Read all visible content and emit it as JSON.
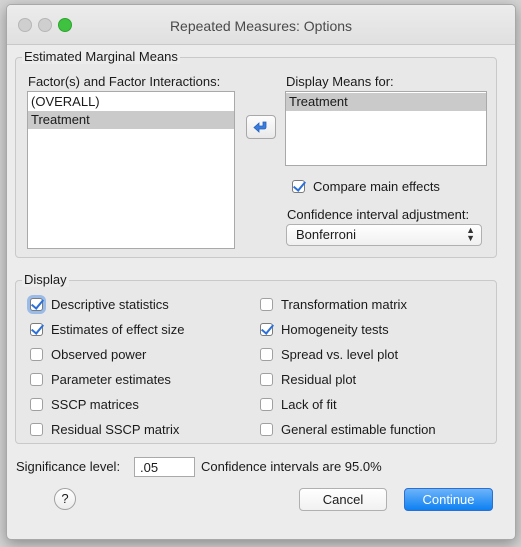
{
  "window": {
    "title": "Repeated Measures: Options"
  },
  "emm": {
    "group_label": "Estimated Marginal Means",
    "factors_label": "Factor(s) and Factor Interactions:",
    "factors": [
      {
        "label": "(OVERALL)",
        "selected": false
      },
      {
        "label": "Treatment",
        "selected": true
      }
    ],
    "display_means_label": "Display Means for:",
    "display_means": [
      {
        "label": "Treatment",
        "selected": true
      }
    ],
    "compare_main_effects": {
      "label": "Compare main effects",
      "checked": true
    },
    "ci_adjustment_label": "Confidence interval adjustment:",
    "ci_adjustment_value": "Bonferroni"
  },
  "display": {
    "group_label": "Display",
    "left": [
      {
        "label": "Descriptive statistics",
        "checked": true
      },
      {
        "label": "Estimates of effect size",
        "checked": true
      },
      {
        "label": "Observed power",
        "checked": false
      },
      {
        "label": "Parameter estimates",
        "checked": false
      },
      {
        "label": "SSCP matrices",
        "checked": false
      },
      {
        "label": "Residual SSCP matrix",
        "checked": false
      }
    ],
    "right": [
      {
        "label": "Transformation matrix",
        "checked": false
      },
      {
        "label": "Homogeneity tests",
        "checked": true
      },
      {
        "label": "Spread vs. level plot",
        "checked": false
      },
      {
        "label": "Residual plot",
        "checked": false
      },
      {
        "label": "Lack of fit",
        "checked": false
      },
      {
        "label": "General estimable function",
        "checked": false
      }
    ]
  },
  "footer": {
    "significance_label": "Significance level:",
    "significance_value": ".05",
    "confidence_text": "Confidence intervals are 95.0%",
    "help_label": "?",
    "cancel_label": "Cancel",
    "continue_label": "Continue"
  },
  "colors": {
    "accent": "#0d80f2",
    "check": "#2c70d8",
    "selection": "#cacaca"
  },
  "icons": {
    "move": "arrow-left-icon",
    "help": "help-icon",
    "select": "chevron-updown-icon"
  }
}
